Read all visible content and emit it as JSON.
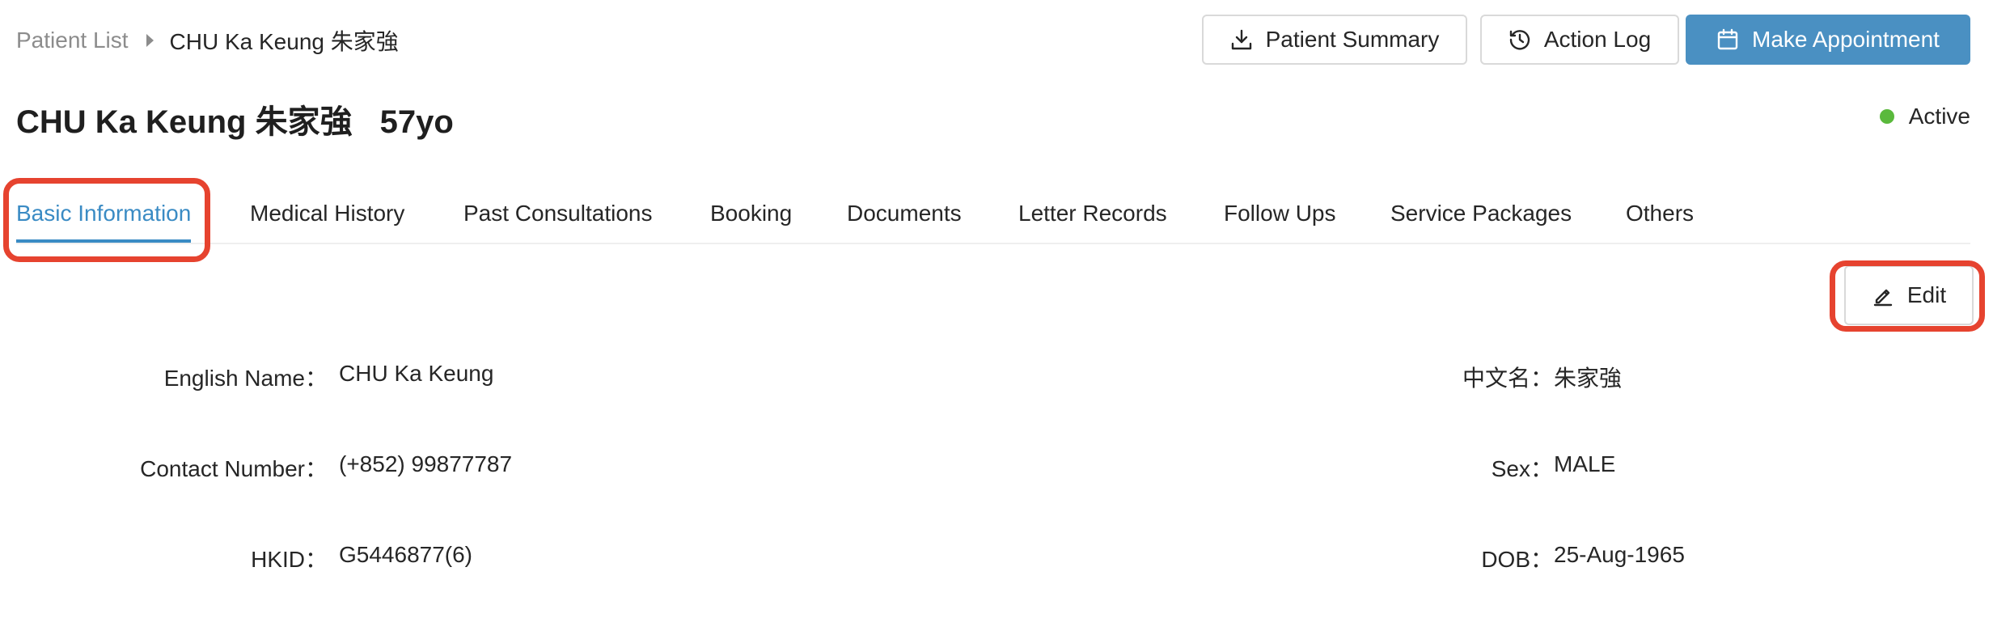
{
  "breadcrumb": {
    "root": "Patient List",
    "current": "CHU Ka Keung 朱家強"
  },
  "header": {
    "patient_summary_label": "Patient Summary",
    "action_log_label": "Action Log",
    "make_appointment_label": "Make Appointment",
    "title_name": "CHU Ka Keung 朱家強",
    "title_age": "57yo",
    "status_label": "Active",
    "status_color": "#5ab93c",
    "primary_color": "#4a90c2",
    "highlight_color": "#e6432f"
  },
  "tabs": [
    {
      "label": "Basic Information",
      "active": true
    },
    {
      "label": "Medical History",
      "active": false
    },
    {
      "label": "Past Consultations",
      "active": false
    },
    {
      "label": "Booking",
      "active": false
    },
    {
      "label": "Documents",
      "active": false
    },
    {
      "label": "Letter Records",
      "active": false
    },
    {
      "label": "Follow Ups",
      "active": false
    },
    {
      "label": "Service Packages",
      "active": false
    },
    {
      "label": "Others",
      "active": false
    }
  ],
  "actions": {
    "edit_label": "Edit"
  },
  "fields": {
    "english_name": {
      "label": "English Name：",
      "value": "CHU Ka Keung"
    },
    "chinese_name": {
      "label": "中文名：",
      "value": "朱家強"
    },
    "contact_number": {
      "label": "Contact Number：",
      "value": "(+852) 99877787"
    },
    "sex": {
      "label": "Sex：",
      "value": "MALE"
    },
    "hkid": {
      "label": "HKID：",
      "value": "G5446877(6)"
    },
    "dob": {
      "label": "DOB：",
      "value": "25-Aug-1965"
    }
  }
}
